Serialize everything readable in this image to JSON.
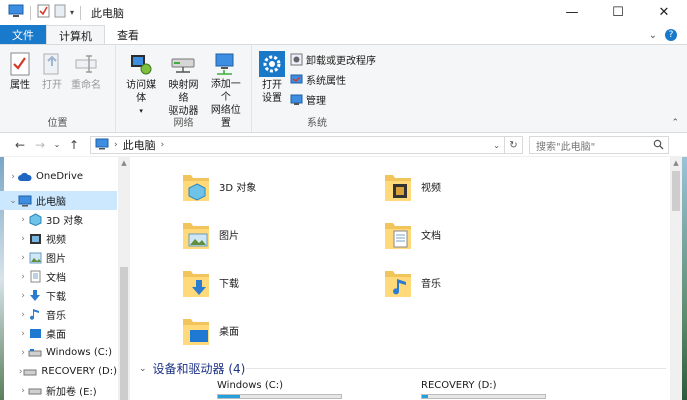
{
  "window": {
    "title": "此电脑",
    "minimize": "—",
    "maximize": "☐",
    "close": "✕"
  },
  "ribbon_tabs": [
    {
      "label": "文件"
    },
    {
      "label": "计算机"
    },
    {
      "label": "查看"
    }
  ],
  "ribbon": {
    "groups": [
      {
        "label": "位置",
        "buttons": [
          "属性",
          "打开",
          "重命名"
        ]
      },
      {
        "label": "网络",
        "buttons": [
          "访问媒体",
          "映射网络\n驱动器",
          "添加一个\n网络位置"
        ]
      },
      {
        "label": "系统",
        "big_button": "打开\n设置",
        "small_buttons": [
          "卸载或更改程序",
          "系统属性",
          "管理"
        ]
      }
    ]
  },
  "address": {
    "path": "此电脑",
    "search_placeholder": "搜索\"此电脑\""
  },
  "nav_tree": [
    {
      "label": "OneDrive",
      "icon": "cloud-icon"
    },
    {
      "label": "此电脑",
      "icon": "computer-icon",
      "selected": true
    },
    {
      "label": "3D 对象",
      "icon": "3d-objects-icon"
    },
    {
      "label": "视频",
      "icon": "video-icon"
    },
    {
      "label": "图片",
      "icon": "pictures-icon"
    },
    {
      "label": "文档",
      "icon": "documents-icon"
    },
    {
      "label": "下载",
      "icon": "download-icon"
    },
    {
      "label": "音乐",
      "icon": "music-icon"
    },
    {
      "label": "桌面",
      "icon": "desktop-icon"
    },
    {
      "label": "Windows (C:)",
      "icon": "drive-icon"
    },
    {
      "label": "RECOVERY (D:)",
      "icon": "drive-icon"
    },
    {
      "label": "新加卷 (E:)",
      "icon": "drive-icon"
    }
  ],
  "folders": [
    {
      "label": "3D 对象",
      "icon": "3d-objects-folder-icon"
    },
    {
      "label": "视频",
      "icon": "video-folder-icon"
    },
    {
      "label": "图片",
      "icon": "pictures-folder-icon"
    },
    {
      "label": "文档",
      "icon": "documents-folder-icon"
    },
    {
      "label": "下载",
      "icon": "download-folder-icon"
    },
    {
      "label": "音乐",
      "icon": "music-folder-icon"
    },
    {
      "label": "桌面",
      "icon": "desktop-folder-icon"
    }
  ],
  "devices_section": {
    "title": "设备和驱动器 (4)",
    "drives": [
      {
        "label": "Windows (C:)",
        "used_fraction": 0.18
      },
      {
        "label": "RECOVERY (D:)",
        "used_fraction": 0.05
      }
    ]
  },
  "colors": {
    "accent": "#1979ca",
    "selection": "#cce8ff",
    "section_title": "#1e3287",
    "drive_bar": "#26a0da"
  }
}
